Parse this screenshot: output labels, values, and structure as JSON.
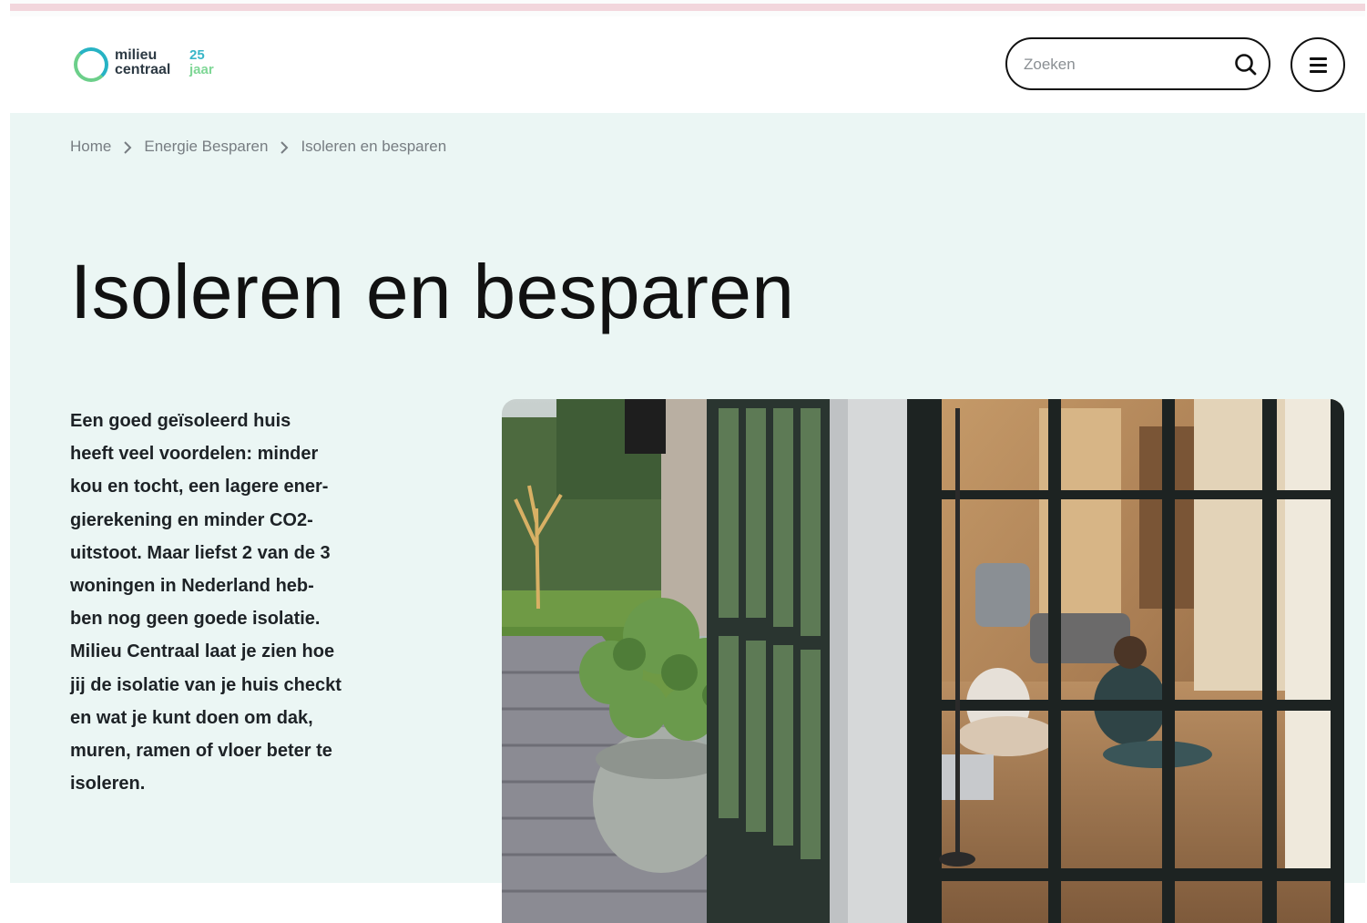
{
  "header": {
    "logo": {
      "line1": "milieu",
      "line2": "centraal",
      "anniversary_number": "25",
      "anniversary_word": "jaar"
    },
    "search": {
      "placeholder": "Zoeken",
      "value": ""
    },
    "icons": {
      "search": "search-icon",
      "menu": "hamburger-menu-icon"
    }
  },
  "breadcrumb": {
    "items": [
      {
        "label": "Home"
      },
      {
        "label": "Energie Besparen"
      },
      {
        "label": "Isoleren en besparen"
      }
    ],
    "separator_icon": "chevron-right-icon"
  },
  "main": {
    "title": "Isoleren en besparen",
    "intro_lines": [
      "Een goed geïsoleerd huis",
      "heeft veel voordelen: minder",
      "kou en tocht, een lagere ener-",
      "gierekening en minder CO2-",
      "uitstoot. Maar liefst 2 van de 3",
      "woningen in Nederland heb-",
      "ben nog geen goede isolatie.",
      "Milieu Centraal laat je zien hoe",
      "jij de isolatie van je huis checkt",
      "en wat je kunt doen om dak,",
      "muren, ramen of vloer beter te",
      "isoleren."
    ]
  },
  "colors": {
    "hero_background": "#ebf6f4",
    "accent_teal": "#27b3c4",
    "accent_green": "#6ccf8a",
    "top_strip_pink": "#f2d6dc"
  }
}
